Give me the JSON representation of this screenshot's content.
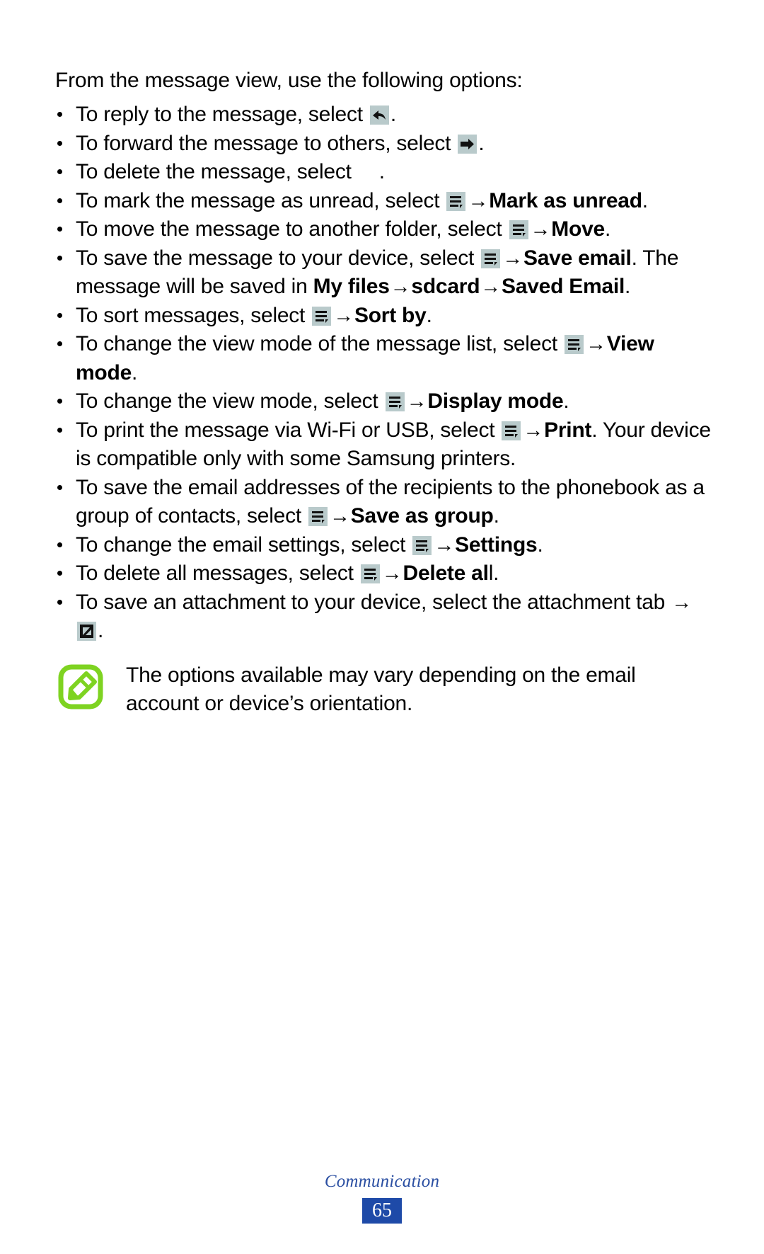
{
  "document": {
    "intro": "From the message view, use the following options:",
    "bullets": [
      {
        "id": "reply",
        "parts": [
          {
            "t": "text",
            "v": "To reply to the message, select "
          },
          {
            "t": "icon",
            "v": "reply-icon"
          },
          {
            "t": "text",
            "v": "."
          }
        ]
      },
      {
        "id": "forward",
        "parts": [
          {
            "t": "text",
            "v": "To forward the message to others, select "
          },
          {
            "t": "icon",
            "v": "forward-icon"
          },
          {
            "t": "text",
            "v": "."
          }
        ]
      },
      {
        "id": "delete",
        "parts": [
          {
            "t": "text",
            "v": "To delete the message, select "
          },
          {
            "t": "icon",
            "v": "delete-icon-missing"
          },
          {
            "t": "text",
            "v": "."
          }
        ]
      },
      {
        "id": "mark-as-unread",
        "parts": [
          {
            "t": "text",
            "v": "To mark the message as unread, select "
          },
          {
            "t": "icon",
            "v": "menu-icon"
          },
          {
            "t": "arrow",
            "v": "→"
          },
          {
            "t": "bold",
            "v": "Mark as unread"
          },
          {
            "t": "text",
            "v": "."
          }
        ]
      },
      {
        "id": "move",
        "parts": [
          {
            "t": "text",
            "v": "To move the message to another folder, select "
          },
          {
            "t": "icon",
            "v": "menu-icon"
          },
          {
            "t": "arrow",
            "v": "→"
          },
          {
            "t": "bold",
            "v": "Move"
          },
          {
            "t": "text",
            "v": "."
          }
        ]
      },
      {
        "id": "save-email",
        "parts": [
          {
            "t": "text",
            "v": "To save the message to your device, select "
          },
          {
            "t": "icon",
            "v": "menu-icon"
          },
          {
            "t": "arrow",
            "v": "→"
          },
          {
            "t": "bold",
            "v": "Save email"
          },
          {
            "t": "text",
            "v": ". The message will be saved in "
          },
          {
            "t": "bold",
            "v": "My files"
          },
          {
            "t": "arrow",
            "v": "→"
          },
          {
            "t": "bold",
            "v": "sdcard"
          },
          {
            "t": "arrow",
            "v": "→"
          },
          {
            "t": "bold",
            "v": "Saved Email"
          },
          {
            "t": "text",
            "v": "."
          }
        ]
      },
      {
        "id": "sort-by",
        "parts": [
          {
            "t": "text",
            "v": "To sort messages, select "
          },
          {
            "t": "icon",
            "v": "menu-icon"
          },
          {
            "t": "arrow",
            "v": "→"
          },
          {
            "t": "bold",
            "v": "Sort by"
          },
          {
            "t": "text",
            "v": "."
          }
        ]
      },
      {
        "id": "view-mode",
        "parts": [
          {
            "t": "text",
            "v": "To change the view mode of the message list, select "
          },
          {
            "t": "icon",
            "v": "menu-icon"
          },
          {
            "t": "arrow",
            "v": "→"
          },
          {
            "t": "bold",
            "v": "View mode"
          },
          {
            "t": "text",
            "v": "."
          }
        ]
      },
      {
        "id": "display-mode",
        "parts": [
          {
            "t": "text",
            "v": "To change the view mode, select "
          },
          {
            "t": "icon",
            "v": "menu-icon"
          },
          {
            "t": "arrow",
            "v": "→"
          },
          {
            "t": "bold",
            "v": "Display mode"
          },
          {
            "t": "text",
            "v": "."
          }
        ]
      },
      {
        "id": "print",
        "parts": [
          {
            "t": "text",
            "v": "To print the message via Wi-Fi or USB, select "
          },
          {
            "t": "icon",
            "v": "menu-icon"
          },
          {
            "t": "arrow",
            "v": "→"
          },
          {
            "t": "bold",
            "v": "Print"
          },
          {
            "t": "text",
            "v": ". Your device is compatible only with some Samsung printers."
          }
        ]
      },
      {
        "id": "save-as-group",
        "parts": [
          {
            "t": "text",
            "v": "To save the email addresses of the recipients to the phonebook as a group of contacts, select "
          },
          {
            "t": "icon",
            "v": "menu-icon"
          },
          {
            "t": "arrow",
            "v": "→"
          },
          {
            "t": "bold",
            "v": "Save as group"
          },
          {
            "t": "text",
            "v": "."
          }
        ]
      },
      {
        "id": "settings",
        "parts": [
          {
            "t": "text",
            "v": "To change the email settings, select "
          },
          {
            "t": "icon",
            "v": "menu-icon"
          },
          {
            "t": "arrow",
            "v": "→"
          },
          {
            "t": "bold",
            "v": "Settings"
          },
          {
            "t": "text",
            "v": "."
          }
        ]
      },
      {
        "id": "delete-all",
        "parts": [
          {
            "t": "text",
            "v": "To delete all messages, select "
          },
          {
            "t": "icon",
            "v": "menu-icon"
          },
          {
            "t": "arrow",
            "v": "→"
          },
          {
            "t": "bold",
            "v": "Delete al"
          },
          {
            "t": "text",
            "v": "l."
          }
        ]
      },
      {
        "id": "save-attachment",
        "parts": [
          {
            "t": "text",
            "v": "To save an attachment to your device, select the attachment tab "
          },
          {
            "t": "arrow",
            "v": "→"
          },
          {
            "t": "icon",
            "v": "save-attachment-icon"
          },
          {
            "t": "text",
            "v": "."
          }
        ]
      }
    ],
    "note": {
      "icon": "note-pencil-icon",
      "text": "The options available may vary depending on the email account or device’s orientation."
    },
    "footer": {
      "chapter": "Communication",
      "page_number": "65"
    },
    "colors": {
      "icon_chip_background": "#b9cacb",
      "note_icon_green": "#7ed321",
      "footer_chapter_blue": "#2b4fa2",
      "page_badge_blue": "#1e4aa8",
      "text_black": "#000000"
    }
  }
}
